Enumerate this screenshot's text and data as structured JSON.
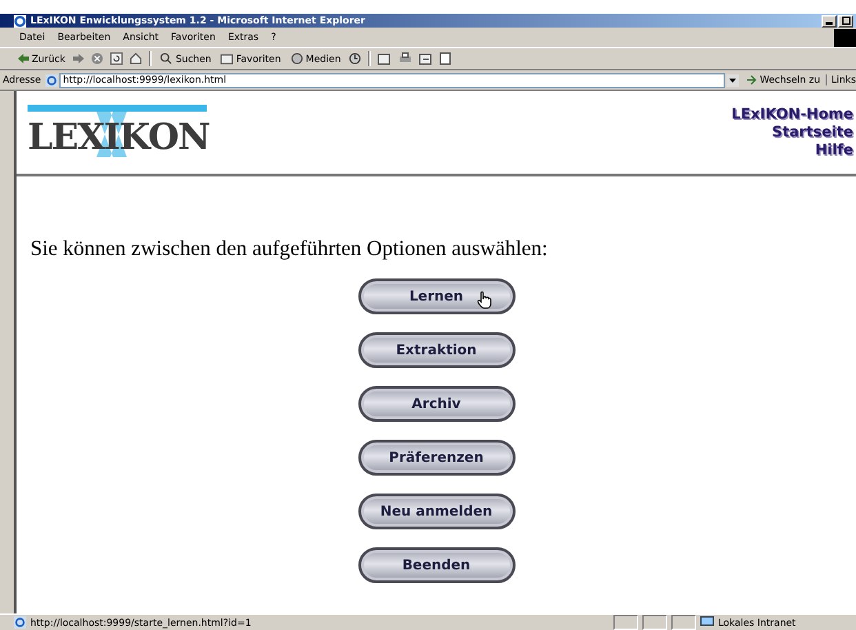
{
  "window": {
    "title": "LExIKON Enwicklungssystem 1.2 - Microsoft Internet Explorer"
  },
  "menu": [
    "Datei",
    "Bearbeiten",
    "Ansicht",
    "Favoriten",
    "Extras",
    "?"
  ],
  "toolbar": {
    "back": "Zurück",
    "search": "Suchen",
    "favorites": "Favoriten",
    "media": "Medien"
  },
  "address_bar": {
    "label": "Adresse",
    "value": "http://localhost:9999/lexikon.html",
    "go": "Wechseln zu",
    "links": "Links"
  },
  "header": {
    "logo": "LEXIKON",
    "nav": [
      "LExIKON-Home",
      "Startseite",
      "Hilfe"
    ]
  },
  "intro": "Sie können zwischen den aufgeführten Optionen auswählen:",
  "options": [
    {
      "label": "Lernen",
      "hovered": true
    },
    {
      "label": "Extraktion",
      "hovered": false
    },
    {
      "label": "Archiv",
      "hovered": false
    },
    {
      "label": "Präferenzen",
      "hovered": false
    },
    {
      "label": "Neu anmelden",
      "hovered": false
    },
    {
      "label": "Beenden",
      "hovered": false
    }
  ],
  "status_bar": {
    "url": "http://localhost:9999/starte_lernen.html?id=1",
    "zone": "Lokales Intranet"
  }
}
